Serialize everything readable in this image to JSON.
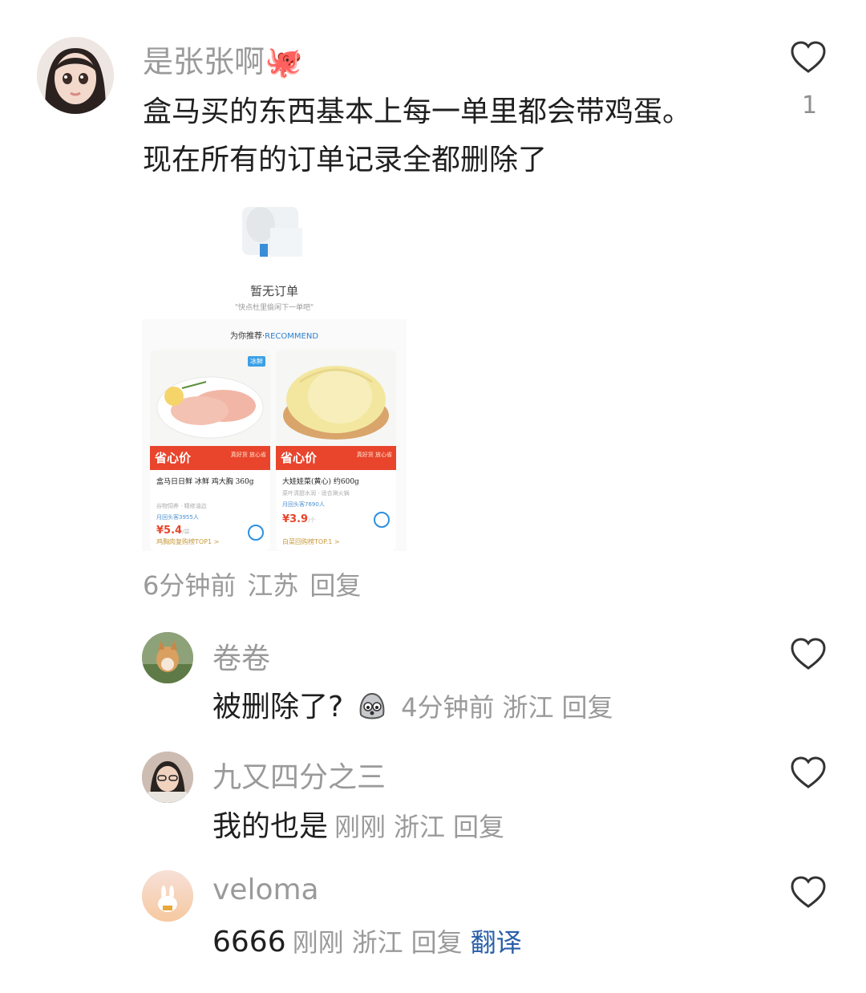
{
  "main_comment": {
    "username": "是张张啊🐙",
    "text_line1": "盒马买的东西基本上每一单里都会带鸡蛋。",
    "text_line2": "现在所有的订单记录全都删除了",
    "like_count": "1",
    "meta": {
      "time": "6分钟前",
      "location": "江苏",
      "reply": "回复"
    },
    "screenshot": {
      "empty_title": "暂无订单",
      "empty_subtitle": "\"快点杜里偷闲下一单吧\"",
      "recommend_cn": "为你推荐·",
      "recommend_en": "RECOMMEND",
      "products": [
        {
          "tag": "冰鲜",
          "band_left": "省心价",
          "band_right": "真好货 放心省",
          "name": "盒马日日鲜 冰鲜 鸡大胸 360g",
          "sub": "谷物饲养 · 精修油边",
          "sold": "月回头客3955人",
          "price": "¥5.4",
          "unit": "/袋",
          "rank": "鸡胸肉复购榜TOP1 >"
        },
        {
          "tag": "",
          "band_left": "省心价",
          "band_right": "真好货 放心省",
          "name": "大娃娃菜(黄心) 约600g",
          "sub": "菜叶清甜水润 · 适合涮火锅",
          "sold": "月回头客7690人",
          "price": "¥3.9",
          "unit": "/个",
          "rank": "白菜回购榜TOP.1 >"
        }
      ]
    }
  },
  "replies": [
    {
      "username": "卷卷",
      "text": "被删除了?",
      "emoji": "worried-face-emoji",
      "time": "4分钟前",
      "location": "浙江",
      "reply": "回复"
    },
    {
      "username": "九又四分之三",
      "text": "我的也是",
      "time": "刚刚",
      "location": "浙江",
      "reply": "回复"
    },
    {
      "username": "veloma",
      "text": "6666",
      "time": "刚刚",
      "location": "浙江",
      "reply": "回复",
      "translate": "翻译"
    }
  ],
  "colors": {
    "meta_gray": "#9a9a9a",
    "translate_blue": "#2a5fa8",
    "price_red": "#e8452c"
  }
}
